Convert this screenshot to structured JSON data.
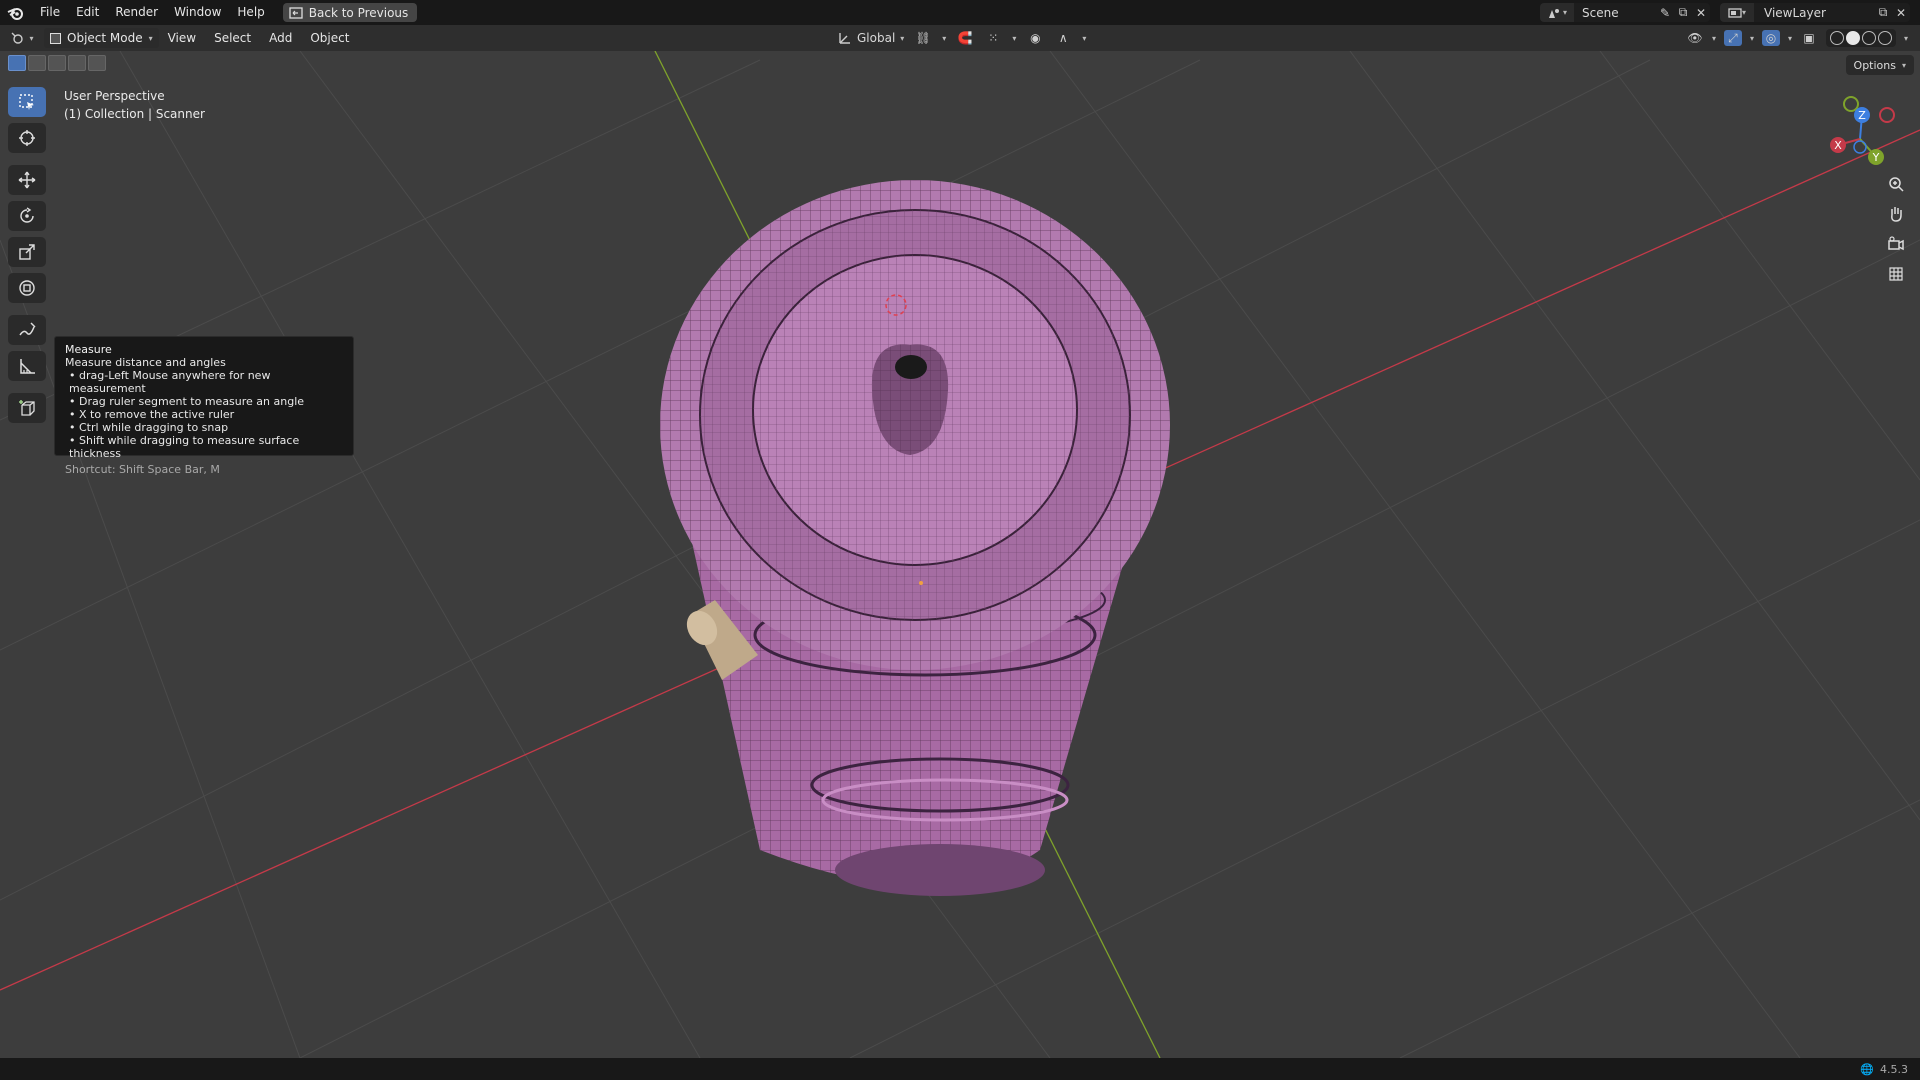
{
  "app": {
    "name": "Blender",
    "version": "4.5.3"
  },
  "topbar": {
    "menus": [
      "File",
      "Edit",
      "Render",
      "Window",
      "Help"
    ],
    "back_button": "Back to Previous",
    "scene": "Scene",
    "view_layer": "ViewLayer"
  },
  "header": {
    "mode": "Object Mode",
    "menus": [
      "View",
      "Select",
      "Add",
      "Object"
    ],
    "transform_orientation": "Global",
    "options_label": "Options"
  },
  "viewport": {
    "view_name": "User Perspective",
    "collection_info": "(1) Collection | Scanner",
    "axes": {
      "x": "X",
      "y": "Y",
      "z": "Z"
    },
    "colors": {
      "x_axis": "#c43a49",
      "y_axis": "#7fa32b",
      "z_axis": "#3d7fe0",
      "object": "#b676b3",
      "grid": "#4a4a4a",
      "knob": "#bfa98a"
    }
  },
  "toolbar": {
    "tools": [
      "select-box",
      "cursor",
      "move",
      "rotate",
      "scale",
      "transform",
      "annotate",
      "measure",
      "add-cube"
    ],
    "active_tool": "select-box"
  },
  "tooltip": {
    "title": "Measure",
    "description": "Measure distance and angles",
    "items": [
      "drag-Left Mouse anywhere for new measurement",
      "Drag ruler segment to measure an angle",
      "X to remove the active ruler",
      "Ctrl while dragging to snap",
      "Shift while dragging to measure surface thickness"
    ],
    "shortcut": "Shortcut: Shift Space Bar, M"
  },
  "statusbar": {
    "version": "4.5.3"
  }
}
